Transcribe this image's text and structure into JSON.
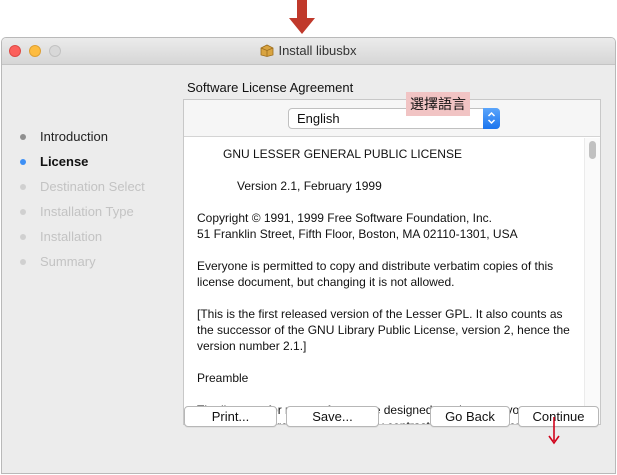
{
  "window": {
    "title": "Install libusbx"
  },
  "sidebar": {
    "steps": [
      {
        "label": "Introduction",
        "state": "done"
      },
      {
        "label": "License",
        "state": "active"
      },
      {
        "label": "Destination Select",
        "state": "pending"
      },
      {
        "label": "Installation Type",
        "state": "pending"
      },
      {
        "label": "Installation",
        "state": "pending"
      },
      {
        "label": "Summary",
        "state": "pending"
      }
    ]
  },
  "main": {
    "section_title": "Software License Agreement",
    "language": {
      "selected": "English"
    },
    "annotation": "選擇語言",
    "license_paragraphs": [
      "GNU LESSER GENERAL PUBLIC LICENSE",
      "Version 2.1, February 1999",
      "Copyright © 1991, 1999 Free Software Foundation, Inc.\n51 Franklin Street, Fifth Floor, Boston, MA 02110-1301, USA",
      "Everyone is permitted to copy and distribute verbatim copies of this\nlicense document, but changing it is not allowed.",
      "[This is the first released version of the Lesser GPL. It also counts as\nthe successor of the GNU Library Public License, version 2, hence the\nversion number 2.1.]",
      "Preamble",
      "The licenses for most software are designed to take away your\nfreedom to share and change it. By contrast, the GNU General Public\nLicenses are intended to guarantee your freedom to share and change\nfree software — to make sure the software is free for all its users."
    ]
  },
  "buttons": {
    "print": "Print...",
    "save": "Save...",
    "go_back": "Go Back",
    "continue": "Continue"
  },
  "colors": {
    "annotation_arrow": "#c0392b",
    "annotation_highlight": "#f1c4c4",
    "accent": "#3d8ff5"
  }
}
